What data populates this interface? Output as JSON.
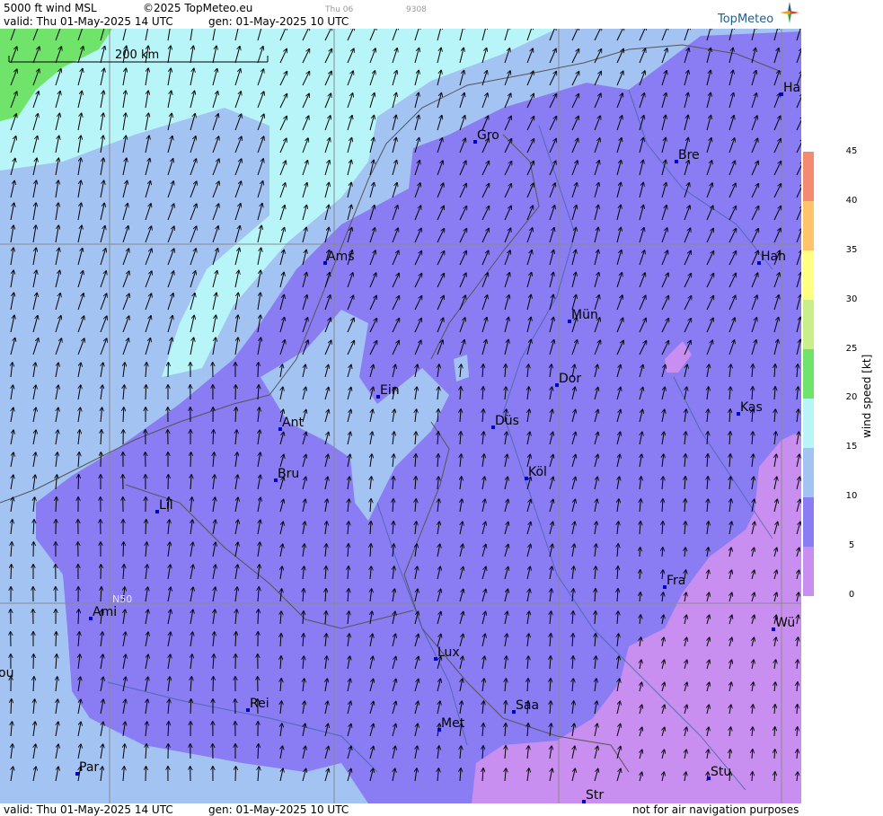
{
  "header": {
    "title": "5000 ft wind MSL",
    "copyright": "©2025 TopMeteo.eu",
    "valid_top": "valid:  Thu  01-May-2025  14 UTC",
    "gen_top": "gen: 01-May-2025 10 UTC",
    "faint_day": "Thu 06",
    "faint_code": "9308",
    "logo": "TopMeteo"
  },
  "footer": {
    "valid": "valid:  Thu  01-May-2025  14 UTC",
    "gen": "gen: 01-May-2025 10 UTC",
    "disclaimer": "not for air navigation purposes"
  },
  "map": {
    "scale_label": "200 km",
    "latitude_label": "N50",
    "cities": [
      "Gro",
      "Bre",
      "Ha",
      "Ams",
      "Han",
      "Mün",
      "Dor",
      "Ein",
      "Kas",
      "Ant",
      "Düs",
      "Bru",
      "Köl",
      "Lil",
      "Fra",
      "Ami",
      "Wü",
      "Lux",
      "ou",
      "Rei",
      "Saa",
      "Met",
      "Par",
      "Stu",
      "Str"
    ]
  },
  "legend": {
    "title": "wind speed  [kt]",
    "ticks": [
      "45",
      "40",
      "35",
      "30",
      "25",
      "20",
      "15",
      "10",
      "5",
      "0"
    ],
    "colors": {
      "0-5": "#c98ff0",
      "5-10": "#8a7cf2",
      "10-15": "#a3c3f3",
      "15-20": "#b8f5f8",
      "20-25": "#6fe36a",
      "25-30": "#c8ef8a",
      "30-35": "#ffff80",
      "35-40": "#ffc46a",
      "40-45": "#f48a6e"
    }
  }
}
